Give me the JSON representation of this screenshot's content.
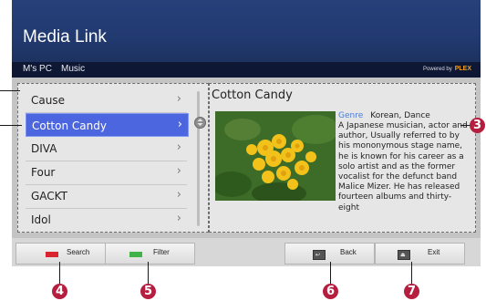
{
  "app": {
    "title": "Media Link"
  },
  "breadcrumb": {
    "items": [
      "M's PC",
      "Music"
    ]
  },
  "branding": {
    "prefix": "Powered by",
    "name": "PLEX"
  },
  "list": {
    "items": [
      {
        "label": "Cause"
      },
      {
        "label": "Cotton Candy"
      },
      {
        "label": "DIVA"
      },
      {
        "label": "Four"
      },
      {
        "label": "GACKT"
      },
      {
        "label": "Idol"
      }
    ],
    "selected_index": 1,
    "chevron": "›"
  },
  "detail": {
    "title": "Cotton Candy",
    "genre_label": "Genre",
    "genre_value": "Korean, Dance",
    "description": "A Japanese musician, actor and author, Usually referred to by his mononymous stage name, he is known for his career as a solo artist and as the former vocalist for the defunct band Malice Mizer. He has released fourteen albums and thirty-eight"
  },
  "buttons": {
    "search": {
      "label": "Search",
      "key_color": "#d9232e"
    },
    "filter": {
      "label": "Filter",
      "key_color": "#3fb24a"
    },
    "back": {
      "label": "Back",
      "icon": "back-key-icon"
    },
    "exit": {
      "label": "Exit",
      "icon": "exit-key-icon"
    }
  },
  "callouts": [
    "3",
    "4",
    "5",
    "6",
    "7"
  ],
  "colors": {
    "header": "#223b72",
    "selection": "#4c66e0",
    "callout": "#b51e3f"
  }
}
